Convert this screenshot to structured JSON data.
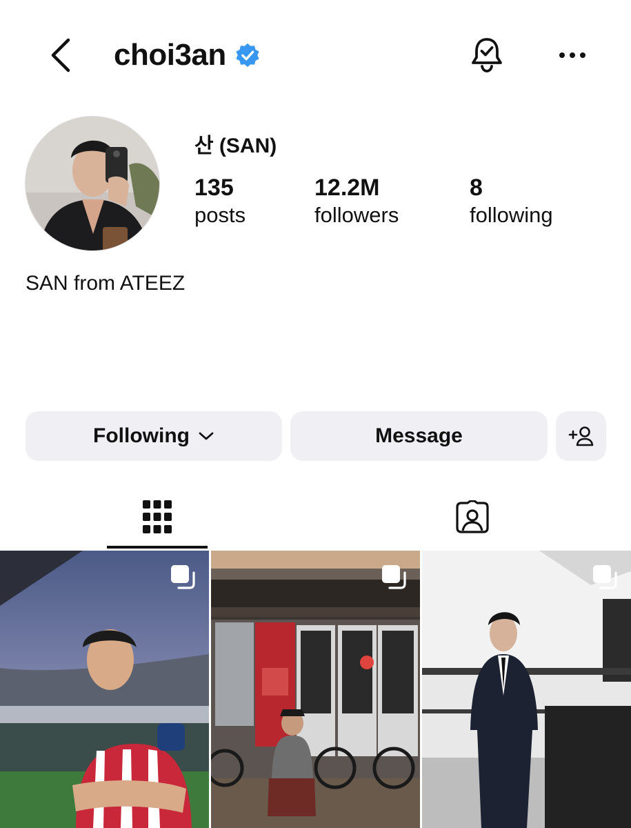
{
  "header": {
    "username": "choi3an",
    "verified": true,
    "icons": [
      "back-chevron-icon",
      "verified-badge-icon",
      "bell-check-icon",
      "more-dots-icon"
    ]
  },
  "profile": {
    "display_name": "산 (SAN)",
    "bio": "SAN from ATEEZ",
    "stats": {
      "posts_count": "135",
      "posts_label": "posts",
      "followers_count": "12.2M",
      "followers_label": "followers",
      "following_count": "8",
      "following_label": "following"
    }
  },
  "actions": {
    "following_label": "Following",
    "message_label": "Message"
  },
  "tabs": [
    {
      "name": "grid",
      "icon": "grid-icon",
      "active": true
    },
    {
      "name": "tagged",
      "icon": "tagged-person-icon",
      "active": false
    }
  ],
  "posts": [
    {
      "type": "carousel",
      "description_icon": "multi-photo-icon"
    },
    {
      "type": "carousel",
      "description_icon": "multi-photo-icon"
    },
    {
      "type": "carousel",
      "description_icon": "multi-photo-icon"
    }
  ],
  "colors": {
    "verified_blue": "#3897f0",
    "button_bg": "#efeff4",
    "text": "#111111",
    "tab_underline": "#111111"
  }
}
